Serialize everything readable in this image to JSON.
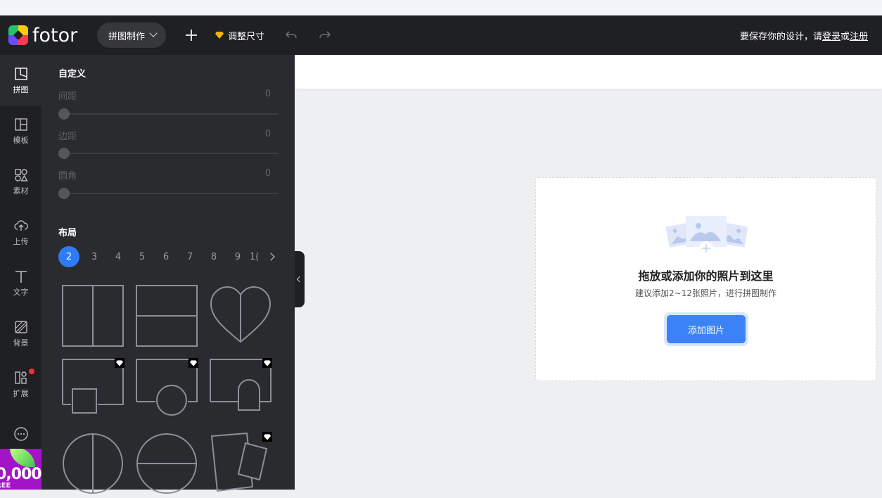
{
  "topbar": {
    "logo_text": "fotor",
    "mode_label": "拼图制作",
    "resize_label": "调整尺寸",
    "save_hint_prefix": "要保存你的设计，请",
    "login_label": "登录",
    "or_label": "或",
    "register_label": "注册"
  },
  "rail": {
    "items": [
      {
        "label": "拼图",
        "icon": "collage-icon"
      },
      {
        "label": "模板",
        "icon": "template-icon"
      },
      {
        "label": "素材",
        "icon": "elements-icon"
      },
      {
        "label": "上传",
        "icon": "upload-icon"
      },
      {
        "label": "文字",
        "icon": "text-icon"
      },
      {
        "label": "背景",
        "icon": "background-icon"
      },
      {
        "label": "扩展",
        "icon": "apps-icon"
      },
      {
        "label": "",
        "icon": "more-icon"
      }
    ],
    "promo_big": "0,000",
    "promo_small": "REE CREDITS"
  },
  "panel": {
    "custom_title": "自定义",
    "sliders": [
      {
        "label": "间距",
        "value": "0"
      },
      {
        "label": "边距",
        "value": "0"
      },
      {
        "label": "圆角",
        "value": "0"
      }
    ],
    "layout_title": "布局",
    "pages": [
      "2",
      "3",
      "4",
      "5",
      "6",
      "7",
      "8",
      "9",
      "1("
    ],
    "active_page": "2"
  },
  "canvas": {
    "drop_title": "拖放或添加你的照片到这里",
    "drop_sub": "建议添加2~12张照片，进行拼图制作",
    "add_button": "添加图片"
  },
  "colors": {
    "accent": "#3b82f6",
    "topbar_bg": "#1f2023",
    "panel_bg": "#2a2b2f",
    "vip_gem": "#f5b800"
  }
}
